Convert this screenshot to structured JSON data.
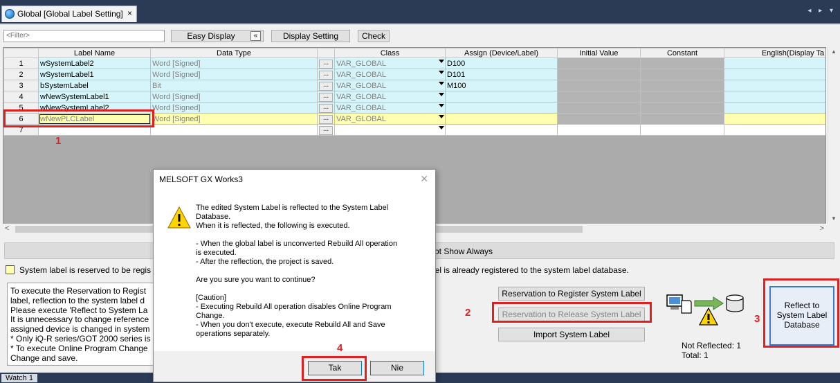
{
  "window": {
    "tab_title": "Global [Global Label Setting]",
    "tab_close": "×",
    "tab_nav": "◂ ▸ ▾"
  },
  "toolbar": {
    "filter_placeholder": "<Filter>",
    "easy_display": "Easy Display",
    "collapse_glyph": "«",
    "display_setting": "Display Setting",
    "check": "Check"
  },
  "grid": {
    "columns": [
      "",
      "Label Name",
      "Data Type",
      "",
      "Class",
      "Assign (Device/Label)",
      "Initial Value",
      "Constant",
      "English(Display Ta"
    ],
    "rows": [
      {
        "no": "1",
        "label": "wSystemLabel2",
        "type": "Word [Signed]",
        "class": "VAR_GLOBAL",
        "assign": "D100"
      },
      {
        "no": "2",
        "label": "wSystemLabel1",
        "type": "Word [Signed]",
        "class": "VAR_GLOBAL",
        "assign": "D101"
      },
      {
        "no": "3",
        "label": "bSystemLabel",
        "type": "Bit",
        "class": "VAR_GLOBAL",
        "assign": "M100"
      },
      {
        "no": "4",
        "label": "wNewSystemLabel1",
        "type": "Word [Signed]",
        "class": "VAR_GLOBAL",
        "assign": ""
      },
      {
        "no": "5",
        "label": "wNewSystemLabel2",
        "type": "Word [Signed]",
        "class": "VAR_GLOBAL",
        "assign": ""
      },
      {
        "no": "6",
        "label": "wNewPLCLabel",
        "type": "Word [Signed]",
        "class": "VAR_GLOBAL",
        "assign": ""
      },
      {
        "no": "7",
        "label": "",
        "type": "",
        "class": "",
        "assign": ""
      }
    ],
    "dots": "...",
    "scroll_left": "<",
    "scroll_right": ">"
  },
  "showbar_text": "ot Show Always",
  "legend": {
    "reserved": "System label is reserved to be regis",
    "registered": "bel is already registered to the system label database."
  },
  "info_lines": [
    "To execute the Reservation to Regist",
    "label, reflection to the system label d",
    "Please execute 'Reflect to System La",
    "It is unnecessary to change reference",
    "assigned device is changed in system",
    "* Only iQ-R series/GOT 2000 series is",
    "* To execute Online Program Change",
    "Change and save."
  ],
  "buttons": {
    "reserve_register": "Reservation to Register System Label",
    "reserve_release": "Reservation to Release System Label",
    "import": "Import System Label",
    "reflect_lines": [
      "Reflect to",
      "System Label",
      "Database"
    ]
  },
  "status": {
    "not_reflected": "Not Reflected: 1",
    "total": "Total: 1"
  },
  "annotations": [
    "1",
    "2",
    "3",
    "4"
  ],
  "dialog": {
    "title": "MELSOFT GX Works3",
    "close": "✕",
    "message": "The edited System Label is reflected to the System Label\nDatabase.\nWhen it is reflected, the following is executed.\n\n- When the global label is unconverted Rebuild All operation\nis executed.\n- After the reflection, the project is saved.\n\nAre you sure you want to continue?\n\n[Caution]\n- Executing Rebuild All operation disables Online Program\nChange.\n- When you don't execute, execute Rebuild All and Save\noperations separately.",
    "yes": "Tak",
    "no": "Nie"
  },
  "bottom_tab": "Watch 1",
  "colors": {
    "annotation_red": "#e02020",
    "cyan_row": "#d6f5fa",
    "yellow_row": "#ffffb0",
    "header_blue": "#2b3a55"
  }
}
